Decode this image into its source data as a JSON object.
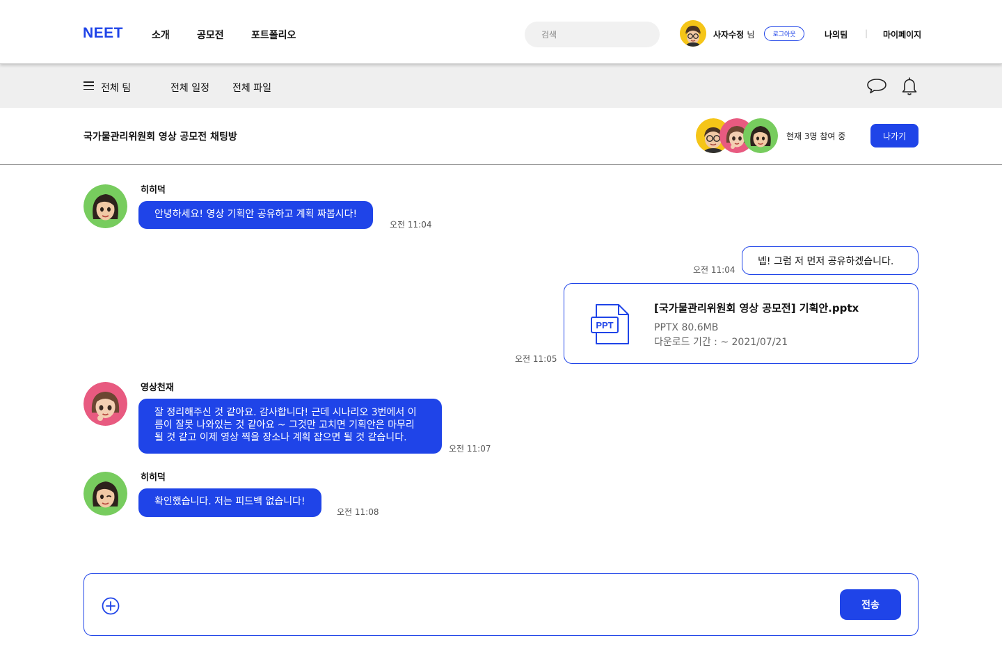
{
  "header": {
    "logo": "NEET",
    "nav": [
      "소개",
      "공모전",
      "포트폴리오"
    ],
    "search_placeholder": "검색",
    "user_name": "사자수정",
    "user_suffix": "님",
    "logout_label": "로그아웃",
    "my_team": "나의팀",
    "separator": "|",
    "my_page": "마이페이지"
  },
  "subnav": {
    "all_teams": "전체 팀",
    "all_schedule": "전체 일정",
    "all_files": "전체 파일"
  },
  "room": {
    "title": "국가물관리위원회 영상 공모전 채팅방",
    "participants_text": "현재 3명 참여 중",
    "exit_label": "나가기"
  },
  "messages": [
    {
      "sender": "히히덕",
      "text": "안녕하세요! 영상 기획안 공유하고 계획 짜봅시다!",
      "time": "오전 11:04"
    },
    {
      "text": "넵! 그럼 저 먼저 공유하겠습니다.",
      "time": "오전 11:04"
    },
    {
      "file": {
        "icon_label": "PPT",
        "name": "[국가물관리위원회 영상 공모전] 기획안.pptx",
        "meta": "PPTX  80.6MB",
        "expiry": "다운로드 기간 : ~ 2021/07/21"
      },
      "time": "오전 11:05"
    },
    {
      "sender": "영상천재",
      "lines": [
        "잘 정리해주신 것 같아요. 감사합니다! 근데 시나리오 3번에서 이",
        "름이 잘못 나와있는 것 같아요 ~ 그것만 고치면 기획안은 마무리",
        "될 것 같고 이제 영상 찍을 장소나 계획 잡으면 될 것 같습니다."
      ],
      "time": "오전 11:07"
    },
    {
      "sender": "히히덕",
      "text": "확인했습니다. 저는 피드백 없습니다!",
      "time": "오전 11:08"
    }
  ],
  "composer": {
    "placeholder": "",
    "send_label": "전송"
  },
  "colors": {
    "accent": "#1f44e8",
    "avatar_yellow": "#f5c518",
    "avatar_pink": "#e85a80",
    "avatar_green": "#77cc5e"
  }
}
